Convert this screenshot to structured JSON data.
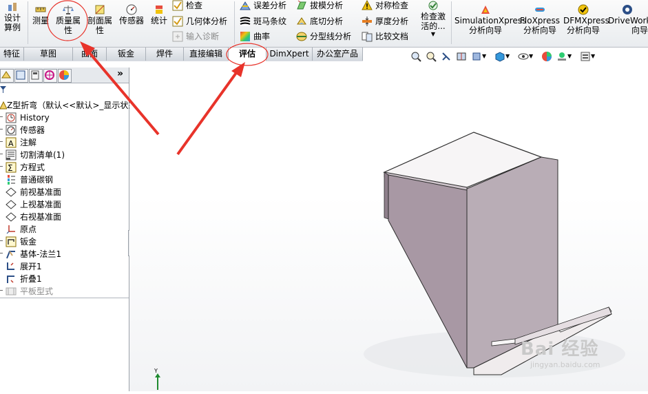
{
  "ribbon": {
    "design_study": "设计算例",
    "measure": "测量",
    "mass_properties": "质量属性",
    "section_properties": "剖面属性",
    "sensor": "传感器",
    "statistics": "统计",
    "check": "检查",
    "geometry_analysis": "几何体分析",
    "import_diagnostics": "输入诊断",
    "deviation_analysis": "误差分析",
    "zebra_stripes": "斑马条纹",
    "curvature": "曲率",
    "draft_analysis": "拔模分析",
    "undercut_analysis": "底切分析",
    "parting_line_analysis": "分型线分析",
    "symmetry_check": "对称检查",
    "thickness_analysis": "厚度分析",
    "compare_documents": "比较文档",
    "check_active": "检查激活的...",
    "simulationxpress": "SimulationXpress 分析向导",
    "floxpress": "FloXpress 分析向导",
    "dfmxpress": "DFMXpress 分析向导",
    "driveworks": "DriveWorks 向导"
  },
  "tabs": [
    "特征",
    "草图",
    "曲面",
    "钣金",
    "焊件",
    "直接编辑",
    "评估",
    "DimXpert",
    "办公室产品"
  ],
  "tree": {
    "root": "Z型折弯（默认<<默认>_显示状态",
    "items": [
      "History",
      "传感器",
      "注解",
      "切割清单(1)",
      "方程式",
      "普通碳钢",
      "前视基准面",
      "上视基准面",
      "右视基准面",
      "原点",
      "钣金",
      "基体-法兰1",
      "展开1",
      "折叠1",
      "平板型式"
    ]
  },
  "axis_label": "Y",
  "watermark": {
    "brand": "Bai 经验",
    "url": "jingyan.baidu.com"
  },
  "colors": {
    "annotation": "#e8332a",
    "part_face_top": "#f6f4f4",
    "part_face_side": "#a898a4",
    "part_edge": "#2b2b2b"
  }
}
